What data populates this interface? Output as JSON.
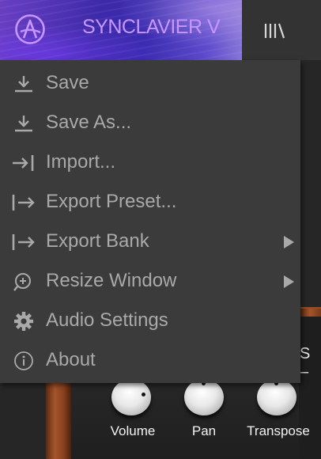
{
  "header": {
    "product_name": "SYNCLAVIER V",
    "logo_icon": "arturia-logo-icon",
    "library_icon": "library-icon"
  },
  "menu": {
    "items": [
      {
        "label": "Save",
        "icon": "download-icon",
        "has_submenu": false
      },
      {
        "label": "Save As...",
        "icon": "download-icon",
        "has_submenu": false
      },
      {
        "label": "Import...",
        "icon": "import-icon",
        "has_submenu": false
      },
      {
        "label": "Export Preset...",
        "icon": "export-icon",
        "has_submenu": false
      },
      {
        "label": "Export Bank",
        "icon": "export-icon",
        "has_submenu": true
      },
      {
        "label": "Resize Window",
        "icon": "zoom-in-icon",
        "has_submenu": true
      },
      {
        "label": "Audio Settings",
        "icon": "gear-icon",
        "has_submenu": false
      },
      {
        "label": "About",
        "icon": "info-icon",
        "has_submenu": false
      }
    ]
  },
  "instrument": {
    "section_label": "S –",
    "knobs": [
      {
        "label": "Volume"
      },
      {
        "label": "Pan"
      },
      {
        "label": "Transpose"
      }
    ]
  },
  "colors": {
    "accent_purple": "#c896ff",
    "menu_bg": "#3b3b3b",
    "menu_text": "#a9a9a9"
  }
}
